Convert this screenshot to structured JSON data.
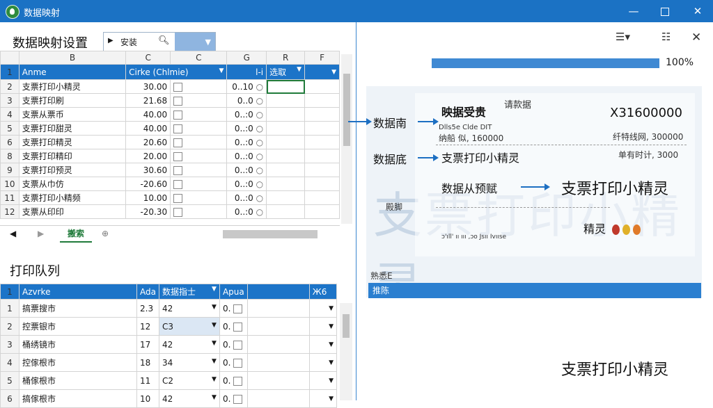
{
  "window": {
    "title": "数据映射",
    "min": "—",
    "close": "✕"
  },
  "mapping": {
    "title": "数据映射设置",
    "combo": {
      "text": "安装",
      "arrow": "▶",
      "search_icon": "search-icon"
    },
    "col_letters": [
      "",
      "B",
      "C",
      "C",
      "G",
      "R",
      "F"
    ],
    "headers": [
      "Anme",
      "Cirke (Chlmie)",
      "",
      "l-i",
      "选取",
      ""
    ],
    "rows": [
      {
        "n": "2",
        "name": "支票打印小精灵",
        "v": "30.00",
        "g": "0..10"
      },
      {
        "n": "3",
        "name": "支票打印刷",
        "v": "21.68",
        "g": "0..0"
      },
      {
        "n": "4",
        "name": "支票从票币",
        "v": "40.00",
        "g": "0..:0"
      },
      {
        "n": "5",
        "name": "支票打印甜灵",
        "v": "40.00",
        "g": "0..:0"
      },
      {
        "n": "6",
        "name": "支票打印精灵",
        "v": "20.60",
        "g": "0..:0"
      },
      {
        "n": "8",
        "name": "支票打印精印",
        "v": "20.00",
        "g": "0..:0"
      },
      {
        "n": "9",
        "name": "支票打印预灵",
        "v": "30.60",
        "g": "0..:0"
      },
      {
        "n": "10",
        "name": "支票从巾仿",
        "v": "-20.60",
        "g": "0..:0"
      },
      {
        "n": "11",
        "name": "支票打印小精频",
        "v": "10.00",
        "g": "0..:0"
      },
      {
        "n": "12",
        "name": "支票从印印",
        "v": "-20.30",
        "g": "0..:0"
      }
    ],
    "sheet_tab": "搬索"
  },
  "queue": {
    "title": "打印队列",
    "headers": [
      "Azvrke",
      "Ada",
      "数据指士",
      "Apua",
      "",
      "Ж6"
    ],
    "rows": [
      {
        "n": "1",
        "name": "搞票搜市",
        "a": "2.3",
        "b": "42",
        "c": "0."
      },
      {
        "n": "2",
        "name": "控票银市",
        "a": "12",
        "b": "C3",
        "c": "0."
      },
      {
        "n": "3",
        "name": "桶绣镜市",
        "a": "17",
        "b": "42",
        "c": "0."
      },
      {
        "n": "4",
        "name": "控傢根市",
        "a": "18",
        "b": "34",
        "c": "0."
      },
      {
        "n": "5",
        "name": "桶傢根市",
        "a": "11",
        "b": "C2",
        "c": "0."
      },
      {
        "n": "6",
        "name": "搞傢根市",
        "a": "10",
        "b": "42",
        "c": "0."
      }
    ]
  },
  "preview": {
    "progress_pct": 100,
    "progress_label": "100%",
    "watermark": "支票打印小精灵",
    "ticket_title": "映据受贵",
    "ticket_sub": "请款据",
    "amount": "X31600000",
    "line1_left": "Dlls5e Clde DIT",
    "line1_left2": "纳船 似, 160000",
    "line1_right": "纤特线网, 300000",
    "line2_left": "支票打印小精灵",
    "line2_right": "单有时计, 3000",
    "line3_left": "数据从预赋",
    "side_label": "殿脚",
    "small_line": "ɔ'ıll' ıı ııı ,ɔo Jsıı Ivııse",
    "corner_label": "精灵",
    "bottom_label": "熟悉E",
    "blue_bar": "推陈",
    "label_a": "数据南",
    "label_b": "数据底",
    "label_c": "支票打印小精灵",
    "footer": "支票打印小精灵",
    "colors": {
      "accent": "#1c74c8",
      "progress": "#3f89d3"
    }
  }
}
